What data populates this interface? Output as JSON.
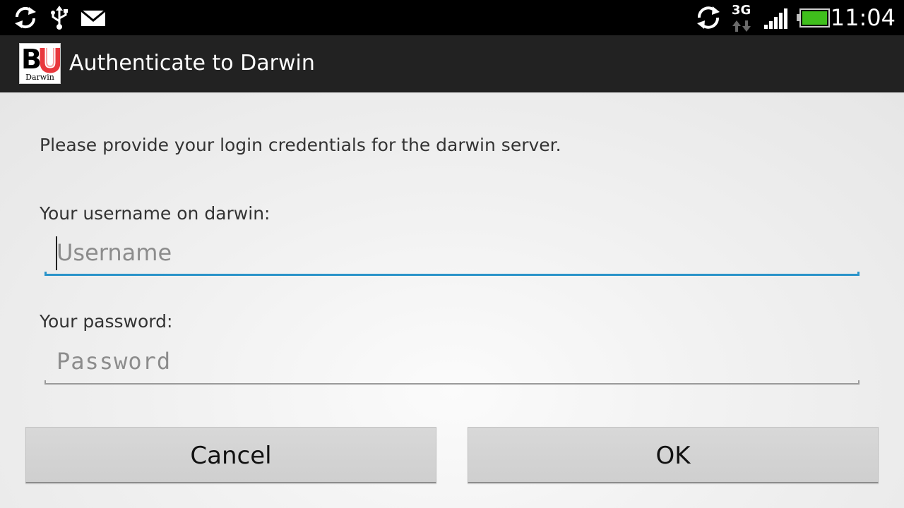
{
  "status_bar": {
    "time": "11:04",
    "network_type": "3G",
    "icons": {
      "left": [
        "sync-icon",
        "usb-icon",
        "mail-icon"
      ],
      "right": [
        "sync-icon",
        "network-3g-icon",
        "signal-icon",
        "battery-icon"
      ]
    },
    "battery_color": "#3fbf1c"
  },
  "action_bar": {
    "title": "Authenticate to Darwin",
    "logo": {
      "letters_b": "B",
      "letters_u": "U",
      "caption": "Darwin"
    }
  },
  "form": {
    "intro": "Please provide your login credentials for the darwin server.",
    "username": {
      "label": "Your username on darwin:",
      "placeholder": "Username",
      "value": ""
    },
    "password": {
      "label": "Your password:",
      "placeholder": "Password",
      "value": ""
    },
    "accent_color": "#2a93c9"
  },
  "buttons": {
    "cancel": "Cancel",
    "ok": "OK"
  }
}
